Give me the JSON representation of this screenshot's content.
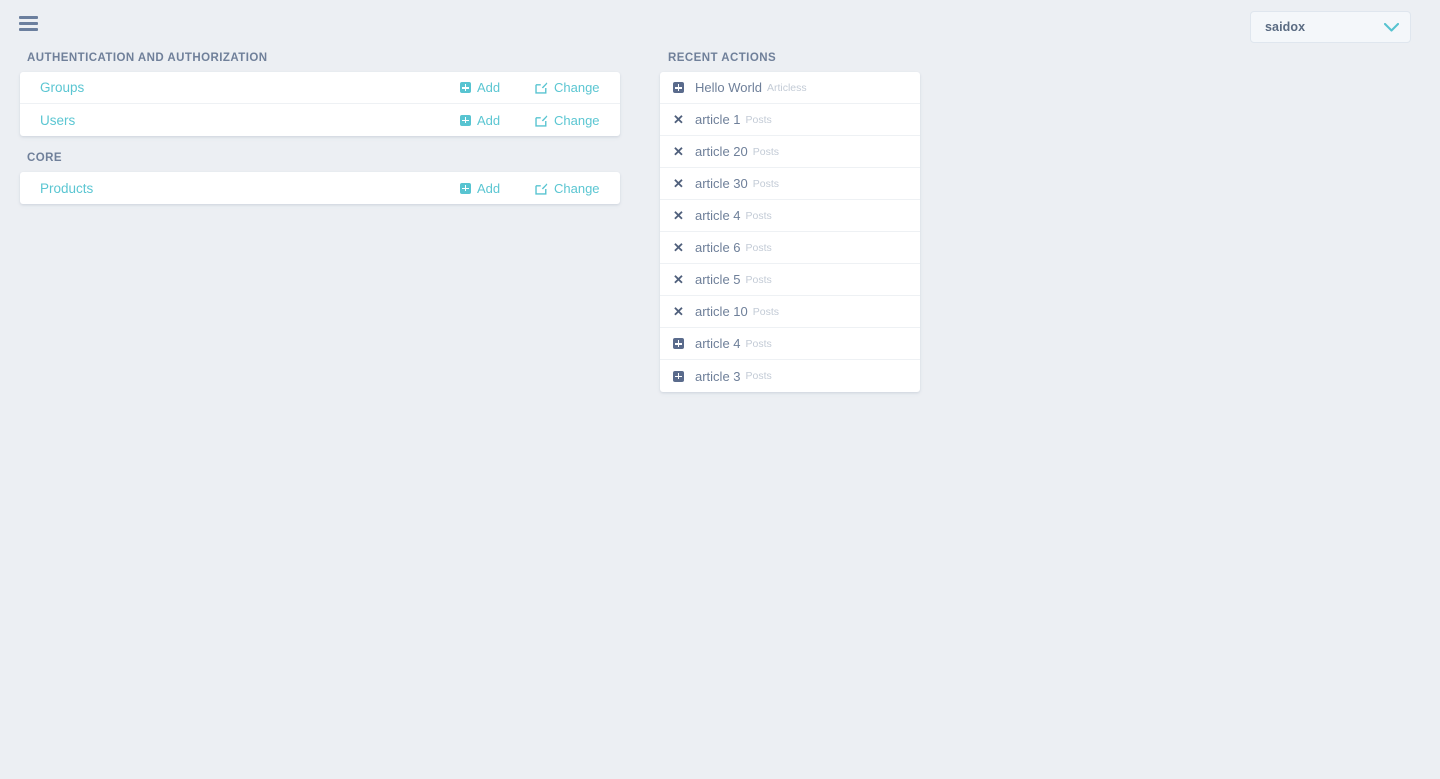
{
  "topbar": {
    "menu_icon": "hamburger-icon",
    "user": {
      "name": "saidox",
      "chevron_icon": "chevron-down-icon"
    }
  },
  "main": {
    "app_sections": [
      {
        "title": "AUTHENTICATION AND AUTHORIZATION",
        "models": [
          {
            "name": "Groups",
            "add_label": "Add",
            "change_label": "Change"
          },
          {
            "name": "Users",
            "add_label": "Add",
            "change_label": "Change"
          }
        ]
      },
      {
        "title": "CORE",
        "models": [
          {
            "name": "Products",
            "add_label": "Add",
            "change_label": "Change"
          }
        ]
      }
    ]
  },
  "recent_actions": {
    "title": "RECENT ACTIONS",
    "entries": [
      {
        "label": "Hello World",
        "model": "Articless",
        "action": "add"
      },
      {
        "label": "article 1",
        "model": "Posts",
        "action": "delete"
      },
      {
        "label": "article 20",
        "model": "Posts",
        "action": "delete"
      },
      {
        "label": "article 30",
        "model": "Posts",
        "action": "delete"
      },
      {
        "label": "article 4",
        "model": "Posts",
        "action": "delete"
      },
      {
        "label": "article 6",
        "model": "Posts",
        "action": "delete"
      },
      {
        "label": "article 5",
        "model": "Posts",
        "action": "delete"
      },
      {
        "label": "article 10",
        "model": "Posts",
        "action": "delete"
      },
      {
        "label": "article 4",
        "model": "Posts",
        "action": "add"
      },
      {
        "label": "article 3",
        "model": "Posts",
        "action": "add"
      }
    ]
  },
  "colors": {
    "background": "#eceff3",
    "accent_teal": "#5bc6d2",
    "heading_slate": "#70809a",
    "text_slate": "#6e7f99",
    "muted": "#c3cbd6",
    "card": "#ffffff"
  }
}
